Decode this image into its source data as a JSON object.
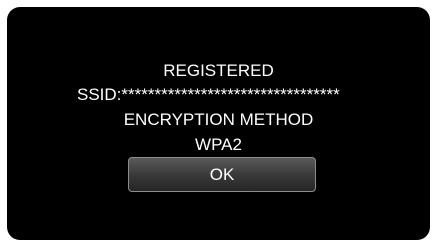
{
  "dialog": {
    "status_text": "REGISTERED",
    "ssid_text": "SSID:*********************************",
    "encryption_label": "ENCRYPTION METHOD",
    "encryption_value": "WPA2",
    "ok_label": "OK"
  }
}
